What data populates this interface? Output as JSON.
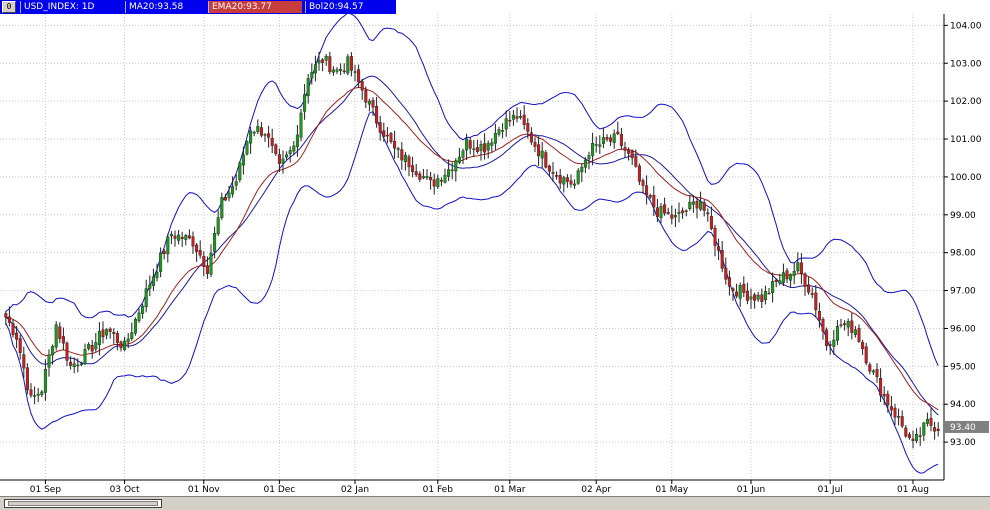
{
  "header": {
    "button_glyph": "0",
    "symbol": "USD_INDEX: 1D",
    "ma": "MA20:93.58",
    "ema": "EMA20:93.77",
    "bol": "Bol20:94.57"
  },
  "colors": {
    "up_candle": "#1a9a1a",
    "down_candle": "#c81e1e",
    "ma_line": "#1a1aa0",
    "ema_line": "#a02020",
    "bollinger": "#1010c8",
    "grid": "#c8c8c8",
    "price_marker": "#808080",
    "header_bar": "#0000ee"
  },
  "icons": {
    "menu_button": "chart-menu-icon"
  },
  "chart_data": {
    "type": "candlestick",
    "title": "USD_INDEX: 1D",
    "ylim": [
      92.0,
      104.3
    ],
    "y_ticks": [
      93,
      94,
      95,
      96,
      97,
      98,
      99,
      100,
      101,
      102,
      103,
      104
    ],
    "y_tick_labels": [
      "93.00",
      "94.00",
      "95.00",
      "96.00",
      "97.00",
      "98.00",
      "99.00",
      "100.00",
      "101.00",
      "102.00",
      "103.00",
      "104.00"
    ],
    "x_tick_labels": [
      "01 Sep",
      "03 Oct",
      "01 Nov",
      "01 Dec",
      "02 Jan",
      "01 Feb",
      "01 Mar",
      "02 Apr",
      "01 May",
      "01 Jun",
      "01 Jul",
      "01 Aug"
    ],
    "x_tick_bar_index": [
      11,
      33,
      55,
      76,
      97,
      120,
      140,
      164,
      185,
      207,
      229,
      252
    ],
    "n_bars": 260,
    "close_anchors": [
      [
        0,
        96.3
      ],
      [
        3,
        95.8
      ],
      [
        7,
        94.1
      ],
      [
        10,
        94.4
      ],
      [
        14,
        96.1
      ],
      [
        18,
        95.0
      ],
      [
        22,
        95.3
      ],
      [
        28,
        96.0
      ],
      [
        33,
        95.5
      ],
      [
        40,
        97.2
      ],
      [
        46,
        98.5
      ],
      [
        52,
        98.3
      ],
      [
        56,
        97.6
      ],
      [
        60,
        99.3
      ],
      [
        64,
        99.9
      ],
      [
        68,
        101.3
      ],
      [
        72,
        101.2
      ],
      [
        76,
        100.2
      ],
      [
        80,
        100.8
      ],
      [
        84,
        102.7
      ],
      [
        88,
        103.1
      ],
      [
        92,
        102.8
      ],
      [
        95,
        103.0
      ],
      [
        99,
        102.3
      ],
      [
        103,
        101.5
      ],
      [
        108,
        100.7
      ],
      [
        113,
        100.3
      ],
      [
        118,
        99.8
      ],
      [
        123,
        100.2
      ],
      [
        128,
        100.9
      ],
      [
        133,
        100.8
      ],
      [
        138,
        101.4
      ],
      [
        142,
        101.6
      ],
      [
        146,
        101.0
      ],
      [
        150,
        100.4
      ],
      [
        154,
        100.0
      ],
      [
        158,
        99.8
      ],
      [
        162,
        100.7
      ],
      [
        166,
        100.9
      ],
      [
        170,
        101.0
      ],
      [
        174,
        100.4
      ],
      [
        177,
        99.6
      ],
      [
        181,
        99.1
      ],
      [
        186,
        98.9
      ],
      [
        190,
        99.2
      ],
      [
        193,
        99.4
      ],
      [
        197,
        98.3
      ],
      [
        201,
        97.1
      ],
      [
        206,
        96.9
      ],
      [
        210,
        96.8
      ],
      [
        215,
        97.3
      ],
      [
        220,
        97.6
      ],
      [
        224,
        96.9
      ],
      [
        228,
        95.6
      ],
      [
        232,
        96.1
      ],
      [
        236,
        96.0
      ],
      [
        240,
        95.0
      ],
      [
        244,
        94.2
      ],
      [
        248,
        93.6
      ],
      [
        252,
        92.9
      ],
      [
        256,
        93.5
      ],
      [
        259,
        93.4
      ]
    ],
    "last_price": "93.40",
    "indicators": [
      {
        "name": "MA20",
        "value": "93.58"
      },
      {
        "name": "EMA20",
        "value": "93.77"
      },
      {
        "name": "Bol20",
        "value": "94.57"
      }
    ],
    "grid": true
  }
}
